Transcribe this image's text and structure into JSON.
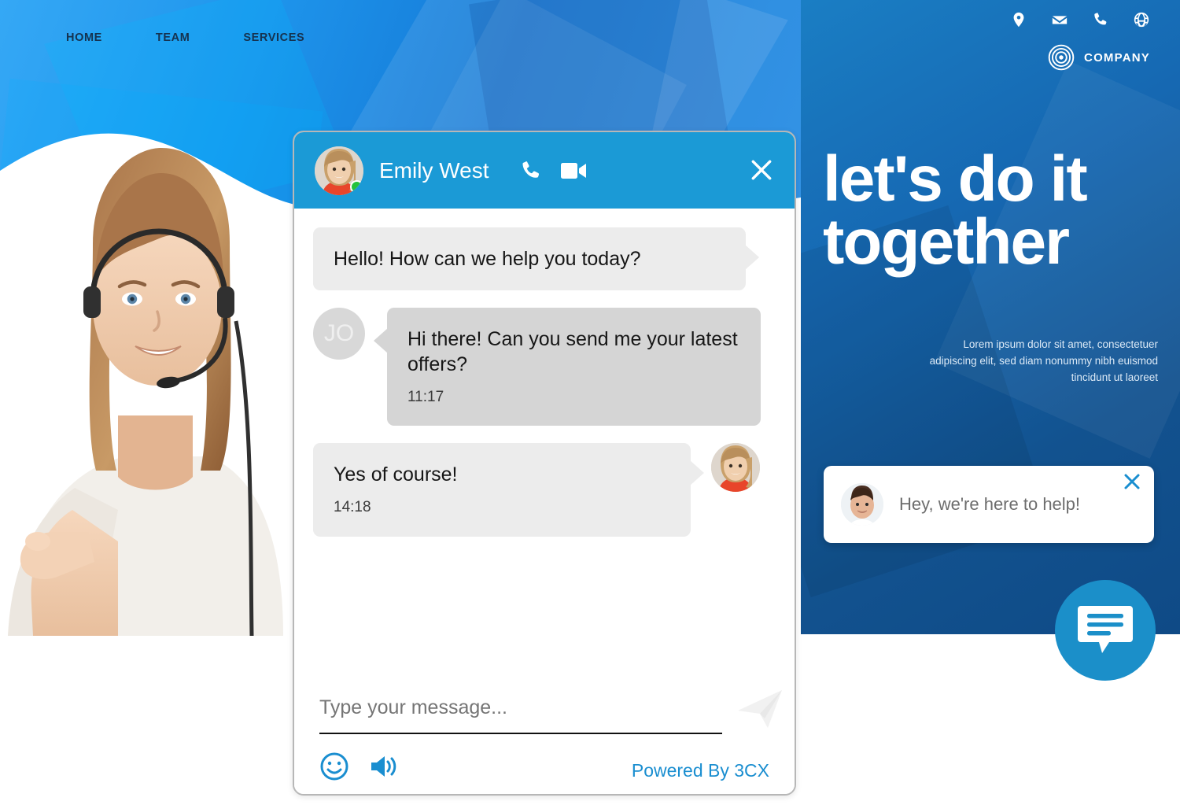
{
  "site": {
    "nav": [
      {
        "label": "HOME"
      },
      {
        "label": "TEAM"
      },
      {
        "label": "SERVICES"
      }
    ],
    "top_icons": [
      {
        "name": "location-pin-icon"
      },
      {
        "name": "mail-icon"
      },
      {
        "name": "phone-icon"
      },
      {
        "name": "globe-icon"
      }
    ],
    "brand_name": "COMPANY",
    "headline": "let's do it together",
    "subcopy": "Lorem ipsum dolor sit amet, consectetuer adipiscing elit, sed diam nonummy nibh euismod tincidunt ut laoreet"
  },
  "toast": {
    "message": "Hey, we're here to help!",
    "close_label": "×"
  },
  "fab": {
    "label": "chat-bubble-icon"
  },
  "chat": {
    "header": {
      "agent_name": "Emily West",
      "status": "online",
      "call_label": "call",
      "video_label": "video",
      "close_label": "close"
    },
    "messages": [
      {
        "id": "m1",
        "side": "agent",
        "text": "Hello! How can we help you today?",
        "time": "",
        "avatar": "none",
        "tail": "right",
        "tone": "light"
      },
      {
        "id": "m2",
        "side": "user",
        "text": "Hi there! Can you send me your latest offers?",
        "time": "11:17",
        "avatar": "JO",
        "tail": "left",
        "tone": "dark"
      },
      {
        "id": "m3",
        "side": "agent",
        "text": "Yes of course!",
        "time": "14:18",
        "avatar": "photo",
        "tail": "right",
        "tone": "light"
      }
    ],
    "footer": {
      "input_value": "",
      "input_placeholder": "Type your message...",
      "emoji_label": "emoji",
      "sound_label": "sound",
      "send_label": "send",
      "powered_by": "Powered By 3CX"
    }
  },
  "colors": {
    "header_blue": "#1b9ad6",
    "panel_blue": "#12528f",
    "accent_blue": "#1a8ed0",
    "online_green": "#24c23c",
    "bubble_light": "#ececec",
    "bubble_dark": "#d5d5d5"
  }
}
